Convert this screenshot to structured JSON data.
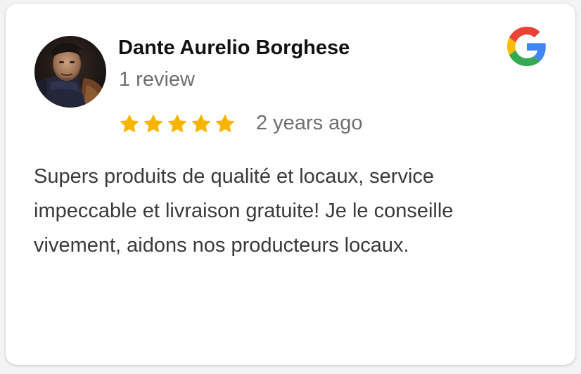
{
  "review": {
    "author_name": "Dante Aurelio Borghese",
    "author_review_count": "1 review",
    "rating": 5,
    "rating_max": 5,
    "relative_time": "2 years ago",
    "text": "Supers produits de qualité et locaux, service impeccable et livraison gratuite! Je le conseille vivement, aidons nos producteurs locaux."
  },
  "icons": {
    "star": "star-icon",
    "source": "google-logo-icon"
  },
  "colors": {
    "star": "#F7B500",
    "name": "#111111",
    "meta": "#6F6F6F",
    "body": "#3A3A3A",
    "google_blue": "#4285F4",
    "google_red": "#EA4335",
    "google_yellow": "#FBBC05",
    "google_green": "#34A853"
  }
}
